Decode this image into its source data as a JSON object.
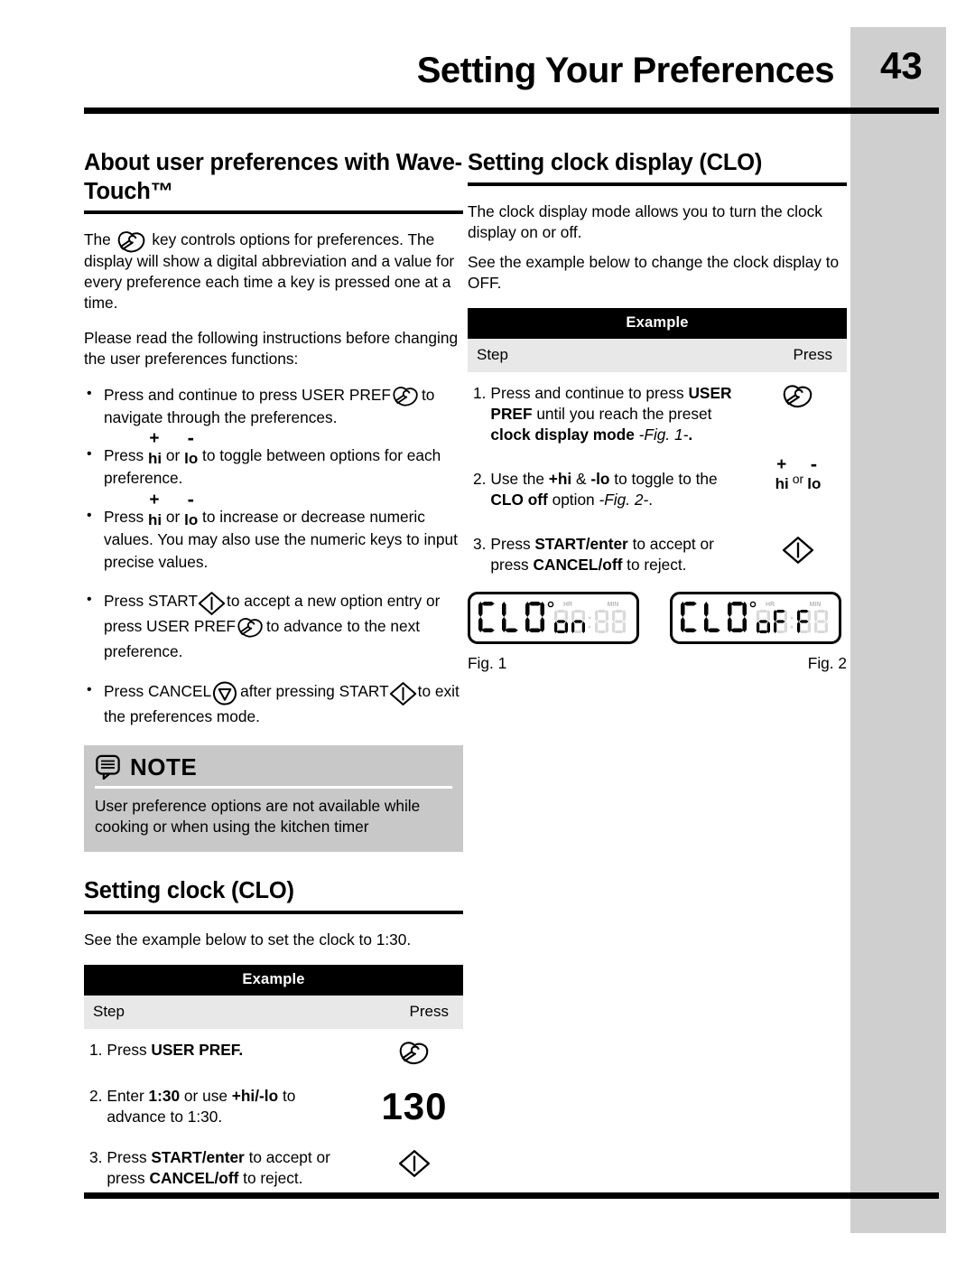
{
  "header": {
    "title": "Setting Your Preferences",
    "page_number": "43"
  },
  "left_column": {
    "heading": "About user preferences with Wave-Touch™",
    "intro_pre": "The",
    "intro_post": "key controls options for preferences. The display will show a digital abbreviation and a value for every preference each time a key is pressed one at a time.",
    "read_instructions": "Please read the following instructions before changing the user preferences functions:",
    "bullets": [
      {
        "pre": "Press and continue to press USER PREF",
        "post": "to navigate through the preferences."
      },
      {
        "pre": "Press",
        "mid": "or",
        "post": "to toggle between options for each preference."
      },
      {
        "pre": "Press",
        "mid": "or",
        "post": "to increase or decrease numeric values. You may also use the numeric keys to input precise values."
      },
      {
        "pre": "Press START",
        "mid": "to accept a new option entry or press USER PREF",
        "post": "to advance to the next preference."
      },
      {
        "pre": "Press CANCEL",
        "mid": "after pressing START",
        "post": "to exit the preferences mode."
      }
    ],
    "note": {
      "title": "NOTE",
      "text": "User preference options are not available while cooking or when using the kitchen timer"
    },
    "clock_heading": "Setting clock (CLO)",
    "clock_intro": "See the example below to set the clock to 1:30.",
    "example": {
      "title": "Example",
      "col_step": "Step",
      "col_press": "Press",
      "rows": [
        {
          "number": "1.",
          "parts": [
            {
              "text": "Press ",
              "style": "normal"
            },
            {
              "text": "USER PREF.",
              "style": "bold"
            }
          ],
          "press_type": "user-pref-icon",
          "press_value": ""
        },
        {
          "number": "2.",
          "parts": [
            {
              "text": "Enter ",
              "style": "normal"
            },
            {
              "text": "1:30",
              "style": "bold"
            },
            {
              "text": " or use ",
              "style": "normal"
            },
            {
              "text": "+hi/-lo",
              "style": "bold"
            },
            {
              "text": " to advance to 1:30.",
              "style": "normal"
            }
          ],
          "press_type": "number",
          "press_value": "130"
        },
        {
          "number": "3.",
          "parts": [
            {
              "text": "Press ",
              "style": "normal"
            },
            {
              "text": "START/enter",
              "style": "bold"
            },
            {
              "text": " to accept or press ",
              "style": "normal"
            },
            {
              "text": "CANCEL/off",
              "style": "bold"
            },
            {
              "text": " to reject.",
              "style": "normal"
            }
          ],
          "press_type": "start-icon",
          "press_value": ""
        }
      ]
    }
  },
  "right_column": {
    "heading": "Setting clock display (CLO)",
    "paragraph_1": "The clock display mode allows you to turn the clock display on or off.",
    "paragraph_2": "See the example below to change the clock display to OFF.",
    "example": {
      "title": "Example",
      "col_step": "Step",
      "col_press": "Press",
      "rows": [
        {
          "number": "1.",
          "parts": [
            {
              "text": "Press and continue to press ",
              "style": "normal"
            },
            {
              "text": "USER PREF",
              "style": "bold"
            },
            {
              "text": " until you reach the preset ",
              "style": "normal"
            },
            {
              "text": "clock display mode",
              "style": "bold"
            },
            {
              "text": " -Fig. 1-",
              "style": "italic"
            },
            {
              "text": ".",
              "style": "bold"
            }
          ],
          "press_type": "user-pref-icon",
          "press_value": ""
        },
        {
          "number": "2.",
          "parts": [
            {
              "text": "Use the ",
              "style": "normal"
            },
            {
              "text": "+hi",
              "style": "bold"
            },
            {
              "text": " & ",
              "style": "normal"
            },
            {
              "text": "-lo",
              "style": "bold"
            },
            {
              "text": " to toggle to the ",
              "style": "normal"
            },
            {
              "text": "CLO off",
              "style": "bold"
            },
            {
              "text": " option ",
              "style": "normal"
            },
            {
              "text": "-Fig. 2-",
              "style": "italic"
            },
            {
              "text": ".",
              "style": "normal"
            }
          ],
          "press_type": "hilo",
          "press_value": ""
        },
        {
          "number": "3.",
          "parts": [
            {
              "text": "Press ",
              "style": "normal"
            },
            {
              "text": "START/enter",
              "style": "bold"
            },
            {
              "text": " to accept or press ",
              "style": "normal"
            },
            {
              "text": "CANCEL/off",
              "style": "bold"
            },
            {
              "text": " to reject.",
              "style": "normal"
            }
          ],
          "press_type": "start-icon",
          "press_value": ""
        }
      ]
    },
    "figures": [
      {
        "caption": "Fig. 1",
        "lcd_label": "CLO",
        "lcd_value": "on",
        "lcd_hr": "HR",
        "lcd_min": "MIN"
      },
      {
        "caption": "Fig. 2",
        "lcd_label": "CLO",
        "lcd_value": "oFF",
        "lcd_hr": "HR",
        "lcd_min": "MIN"
      }
    ]
  },
  "glyphs": {
    "plus": "+",
    "minus": "-",
    "hi": "hi",
    "lo": "lo",
    "or": "or"
  },
  "colors": {
    "side_band": "#cfcfcf",
    "note_bg": "#c8c8c8",
    "table_header_bg": "#000000",
    "table_subhead_bg": "#e8e8e8",
    "text": "#000000"
  }
}
